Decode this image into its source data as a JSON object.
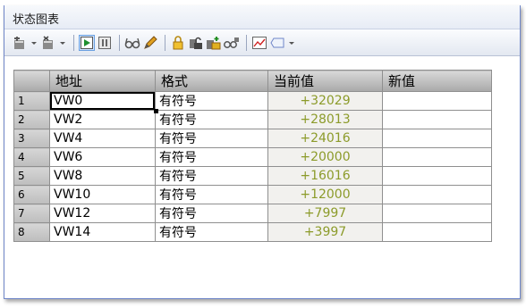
{
  "window": {
    "title": "状态图表"
  },
  "toolbar": {
    "icons": [
      "insert-row-icon",
      "dropdown-arrow-icon",
      "delete-row-icon",
      "dropdown-arrow-icon",
      "run-status-icon",
      "pause-status-icon",
      "read-glasses-icon",
      "write-pencil-icon",
      "force-lock-icon",
      "unforce-icon",
      "force-multiple-icon",
      "read-all-forced-icon",
      "trend-chart-icon",
      "comment-tag-icon",
      "dropdown-arrow-icon"
    ]
  },
  "table": {
    "headers": [
      "",
      "地址",
      "格式",
      "当前值",
      "新值"
    ],
    "rows": [
      {
        "n": "1",
        "addr": "VW0",
        "fmt": "有符号",
        "cur": "+32029",
        "new": ""
      },
      {
        "n": "2",
        "addr": "VW2",
        "fmt": "有符号",
        "cur": "+28013",
        "new": ""
      },
      {
        "n": "3",
        "addr": "VW4",
        "fmt": "有符号",
        "cur": "+24016",
        "new": ""
      },
      {
        "n": "4",
        "addr": "VW6",
        "fmt": "有符号",
        "cur": "+20000",
        "new": ""
      },
      {
        "n": "5",
        "addr": "VW8",
        "fmt": "有符号",
        "cur": "+16016",
        "new": ""
      },
      {
        "n": "6",
        "addr": "VW10",
        "fmt": "有符号",
        "cur": "+12000",
        "new": ""
      },
      {
        "n": "7",
        "addr": "VW12",
        "fmt": "有符号",
        "cur": "+7997",
        "new": ""
      },
      {
        "n": "8",
        "addr": "VW14",
        "fmt": "有符号",
        "cur": "+3997",
        "new": ""
      }
    ]
  },
  "colors": {
    "current_value_text": "#8c9b2a",
    "frame_border": "#6f86c8"
  }
}
